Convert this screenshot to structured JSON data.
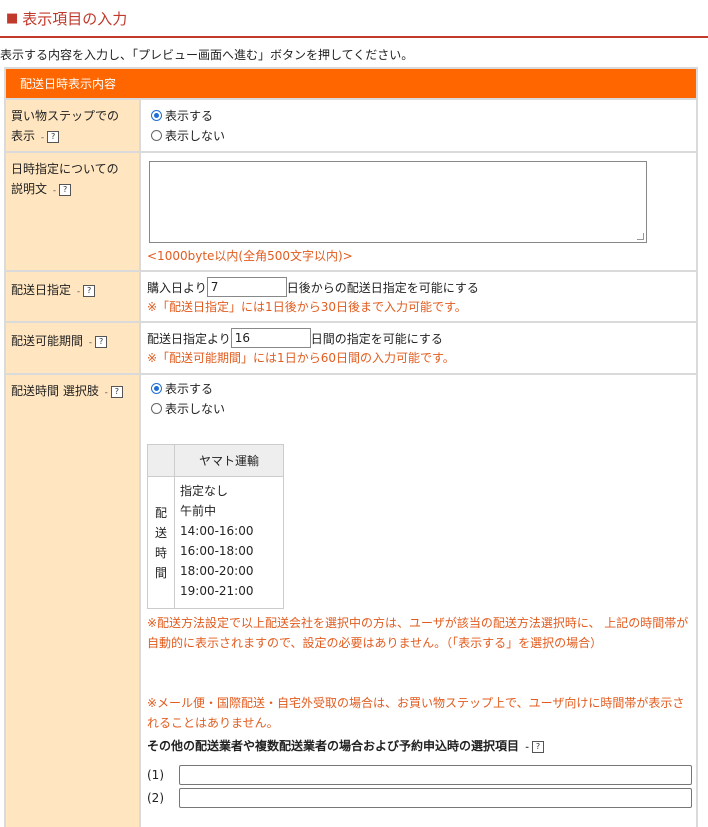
{
  "page": {
    "title": "表示項目の入力",
    "instruction": "表示する内容を入力し、「プレビュー画面へ進む」ボタンを押してください。"
  },
  "section": {
    "header": "配送日時表示内容"
  },
  "help_icon_text": "?",
  "help_dot": "-",
  "rows": {
    "shopping_step": {
      "label_line1": "買い物ステップでの",
      "label_line2": "表示",
      "options": [
        "表示する",
        "表示しない"
      ],
      "selected": "表示する"
    },
    "description": {
      "label_line1": "日時指定についての",
      "label_line2": "説明文",
      "textarea_value": "",
      "note": "<1000byte以内(全角500文字以内)>"
    },
    "delivery_date": {
      "label": "配送日指定",
      "prefix": "購入日より",
      "value": "7",
      "suffix": "日後からの配送日指定を可能にする",
      "note": "※「配送日指定」には1日後から30日後まで入力可能です。"
    },
    "delivery_period": {
      "label": "配送可能期間",
      "prefix": "配送日指定より",
      "value": "16",
      "suffix": "日間の指定を可能にする",
      "note": "※「配送可能期間」には1日から60日間の入力可能です。"
    },
    "delivery_time": {
      "label": "配送時間 選択肢",
      "options": [
        "表示する",
        "表示しない"
      ],
      "selected": "表示する",
      "carrier": "ヤマト運輸",
      "vertical_label": "配送時間",
      "time_slots": [
        "指定なし",
        "午前中",
        "14:00-16:00",
        "16:00-18:00",
        "18:00-20:00",
        "19:00-21:00"
      ],
      "note1": "※配送方法設定で以上配送会社を選択中の方は、ユーザが該当の配送方法選択時に、 上記の時間帯が自動的に表示されますので、設定の必要はありません。（「表示する」を選択の場合）",
      "note2": "※メール便・国際配送・自宅外受取の場合は、お買い物ステップ上で、ユーザ向けに時間帯が表示されることはありません。",
      "other_heading": "その他の配送業者や複数配送業者の場合および予約申込時の選択項目",
      "other_inputs": [
        {
          "number": "(1)",
          "value": ""
        },
        {
          "number": "(2)",
          "value": ""
        }
      ]
    }
  }
}
